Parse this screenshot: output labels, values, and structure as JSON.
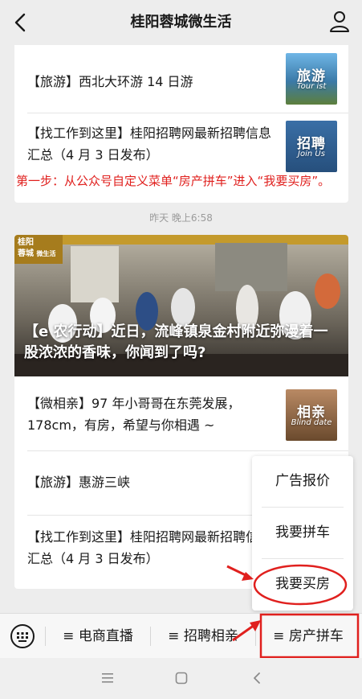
{
  "header": {
    "title": "桂阳蓉城微生活"
  },
  "article_list_top": [
    {
      "text": "【旅游】西北大环游 14 日游",
      "thumb_label": "旅游",
      "thumb_sub": "Tour ist"
    },
    {
      "text": "【找工作到这里】桂阳招聘网最新招聘信息汇总（4 月 3 日发布）",
      "thumb_label": "招聘",
      "thumb_sub": "Join Us"
    }
  ],
  "instruction_note": "第一步：从公众号自定义菜单“房产拼车”进入“我要买房”。",
  "timestamp": "昨天 晚上6:58",
  "feature_article": {
    "badge_line1": "桂阳",
    "badge_line2": "蓉城",
    "badge_line3": "微生活",
    "title": "【e 农行动】近日，流峰镇泉金村附近弥漫着一股浓浓的香味，你闻到了吗?"
  },
  "article_list_bottom": [
    {
      "text": "【微相亲】97 年小哥哥在东莞发展，178cm，有房，希望与你相遇 ~",
      "thumb_label": "相亲",
      "thumb_sub": "Blind date"
    },
    {
      "text": "【旅游】惠游三峡"
    },
    {
      "text": "【找工作到这里】桂阳招聘网最新招聘信息汇总（4 月 3 日发布）"
    }
  ],
  "popup_menu": {
    "items": [
      "广告报价",
      "我要拼车",
      "我要买房"
    ]
  },
  "bottom_menu": {
    "tabs": [
      "≡ 电商直播",
      "≡ 招聘相亲",
      "≡ 房产拼车"
    ]
  },
  "colors": {
    "annotation_red": "#e0201e",
    "background": "#ededed"
  }
}
